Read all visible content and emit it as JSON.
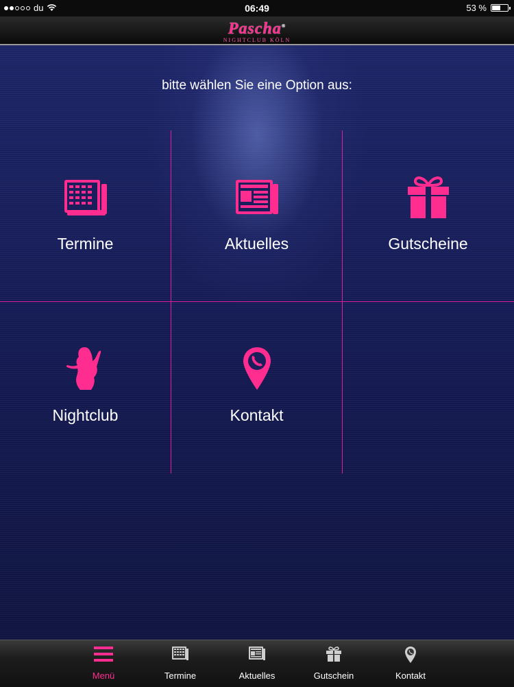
{
  "status_bar": {
    "carrier": "du",
    "time": "06:49",
    "battery_text": "53 %",
    "battery_level": 0.53,
    "signal_bars_filled": 2,
    "signal_bars_total": 5
  },
  "header": {
    "logo_main": "Pascha",
    "logo_registered": "®",
    "logo_sub": "NIGHTCLUB KÖLN"
  },
  "main": {
    "prompt": "bitte wählen Sie eine Option aus:",
    "tiles": [
      {
        "label": "Termine",
        "icon": "calendar-icon"
      },
      {
        "label": "Aktuelles",
        "icon": "newspaper-icon"
      },
      {
        "label": "Gutscheine",
        "icon": "gift-icon"
      },
      {
        "label": "Nightclub",
        "icon": "woman-silhouette-icon"
      },
      {
        "label": "Kontakt",
        "icon": "location-phone-icon"
      }
    ]
  },
  "tabbar": {
    "active": "Menü",
    "tabs": [
      {
        "label": "Menü",
        "icon": "menu-icon"
      },
      {
        "label": "Termine",
        "icon": "calendar-icon"
      },
      {
        "label": "Aktuelles",
        "icon": "newspaper-icon"
      },
      {
        "label": "Gutschein",
        "icon": "gift-icon"
      },
      {
        "label": "Kontakt",
        "icon": "location-phone-icon"
      }
    ]
  },
  "colors": {
    "accent": "#ff2d8f",
    "background": "#141a52",
    "grid_line": "#e0209a"
  }
}
